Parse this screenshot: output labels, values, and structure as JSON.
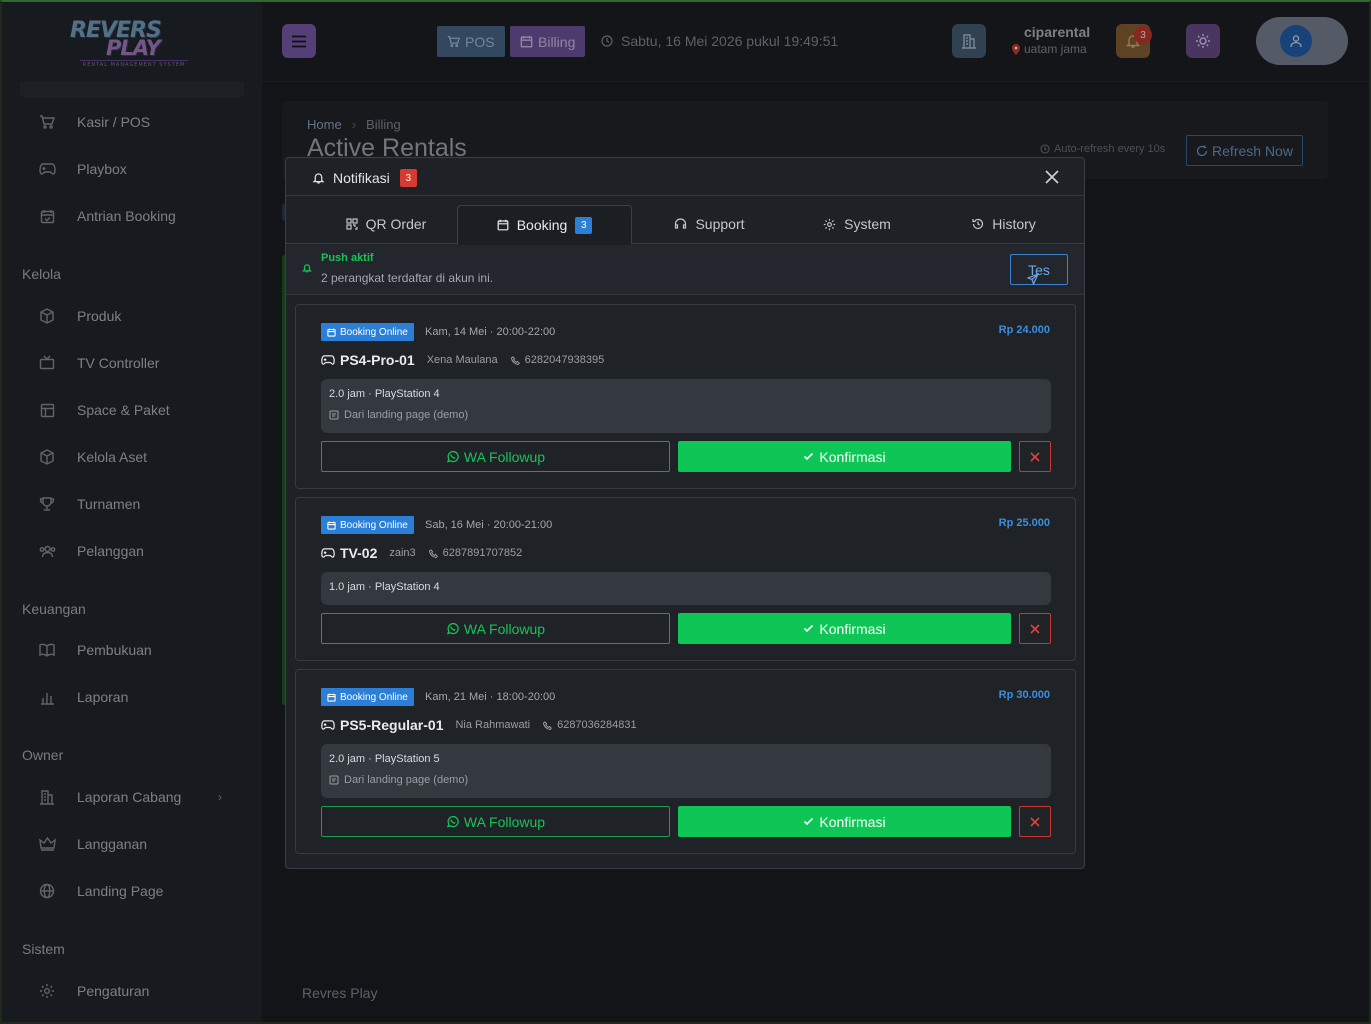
{
  "sidebar": {
    "items_top": [
      {
        "label": "Kasir / POS",
        "icon": "cart-icon"
      },
      {
        "label": "Playbox",
        "icon": "gamepad-icon"
      },
      {
        "label": "Antrian Booking",
        "icon": "calendar-check-icon"
      }
    ],
    "sections": [
      {
        "title": "Kelola",
        "items": [
          {
            "label": "Produk",
            "icon": "box-icon"
          },
          {
            "label": "TV Controller",
            "icon": "tv-icon"
          },
          {
            "label": "Space & Paket",
            "icon": "layout-icon"
          },
          {
            "label": "Kelola Aset",
            "icon": "box-icon"
          },
          {
            "label": "Turnamen",
            "icon": "trophy-icon"
          },
          {
            "label": "Pelanggan",
            "icon": "users-icon"
          }
        ]
      },
      {
        "title": "Keuangan",
        "items": [
          {
            "label": "Pembukuan",
            "icon": "book-icon"
          },
          {
            "label": "Laporan",
            "icon": "bar-chart-icon"
          }
        ]
      },
      {
        "title": "Owner",
        "items": [
          {
            "label": "Laporan Cabang",
            "icon": "building-icon"
          },
          {
            "label": "Langganan",
            "icon": "crown-icon"
          },
          {
            "label": "Landing Page",
            "icon": "globe-icon"
          }
        ]
      },
      {
        "title": "Sistem",
        "items": [
          {
            "label": "Pengaturan",
            "icon": "gear-icon"
          }
        ]
      }
    ]
  },
  "topbar": {
    "pos_label": "POS",
    "billing_label": "Billing",
    "datetime": "Sabtu, 16 Mei 2026 pukul 19:49:51",
    "tenant_name": "ciparental",
    "tenant_branch": "uatam jama",
    "notif_count": "3"
  },
  "page": {
    "crumb_home": "Home",
    "crumb_current": "Billing",
    "title": "Active Rentals",
    "auto_refresh": "Auto-refresh every 10s",
    "refresh_label": "Refresh Now",
    "footer": "Revres Play"
  },
  "modal": {
    "title": "Notifikasi",
    "count": "3",
    "tabs": [
      {
        "label": "QR Order",
        "icon": "qr-icon"
      },
      {
        "label": "Booking",
        "icon": "calendar-icon",
        "count": "3"
      },
      {
        "label": "Support",
        "icon": "headset-icon"
      },
      {
        "label": "System",
        "icon": "gear-icon"
      },
      {
        "label": "History",
        "icon": "history-icon"
      }
    ],
    "push": {
      "title": "Push aktif",
      "subtitle": "2 perangkat terdaftar di akun ini.",
      "test_label": "Tes"
    },
    "bookings": [
      {
        "tag": "Booking Online",
        "date": "Kam, 14 Mei · 20:00-22:00",
        "price": "Rp 24.000",
        "unit": "PS4-Pro-01",
        "customer": "Xena Maulana",
        "phone": "6282047938395",
        "detail": "2.0 jam · PlayStation 4",
        "note": "Dari landing page (demo)"
      },
      {
        "tag": "Booking Online",
        "date": "Sab, 16 Mei · 20:00-21:00",
        "price": "Rp 25.000",
        "unit": "TV-02",
        "customer": "zain3",
        "phone": "6287891707852",
        "detail": "1.0 jam · PlayStation 4",
        "note": ""
      },
      {
        "tag": "Booking Online",
        "date": "Kam, 21 Mei · 18:00-20:00",
        "price": "Rp 30.000",
        "unit": "PS5-Regular-01",
        "customer": "Nia Rahmawati",
        "phone": "6287036284831",
        "detail": "2.0 jam · PlayStation 5",
        "note": "Dari landing page (demo)"
      }
    ],
    "wa_label": "WA Followup",
    "confirm_label": "Konfirmasi"
  },
  "logo": {
    "line1": "REVERS",
    "line2": "PLAY",
    "tagline": "RENTAL MANAGEMENT SYSTEM"
  },
  "colors": {
    "accent": "#7c5fb0",
    "success": "#0dc655",
    "info": "#2b7fd6",
    "danger": "#d63b31"
  }
}
